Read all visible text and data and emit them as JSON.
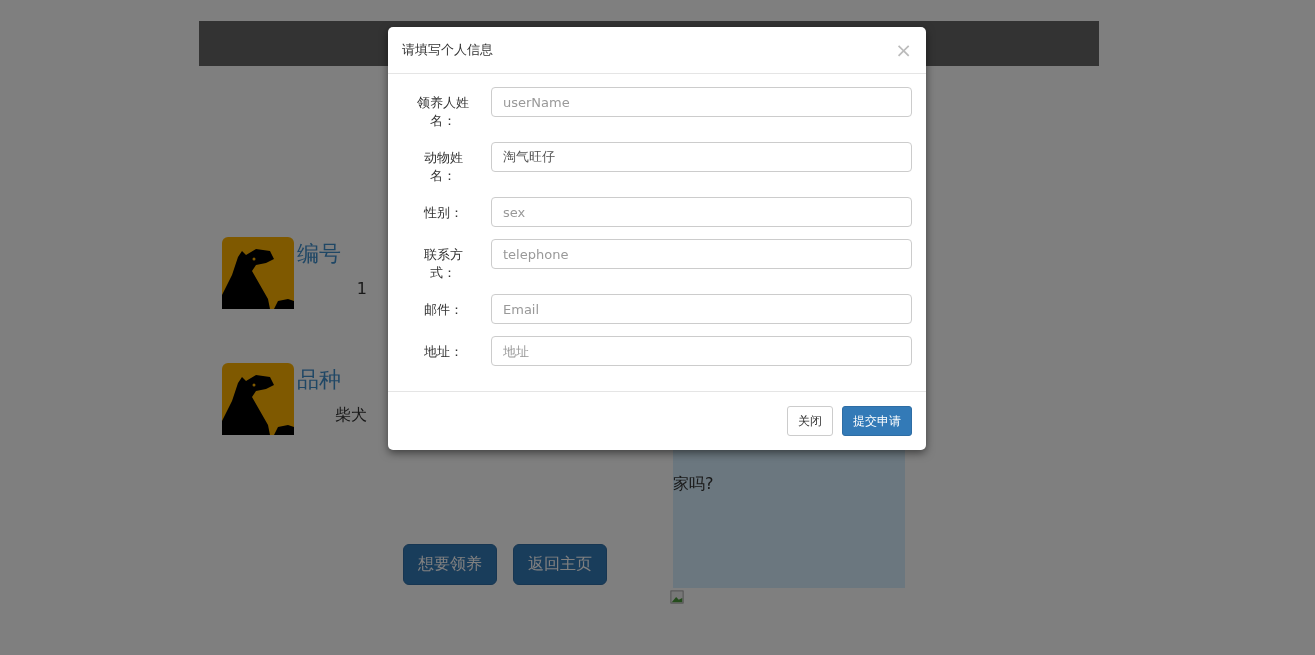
{
  "page": {
    "details": [
      {
        "title": "编号",
        "value": "1"
      },
      {
        "title": "品种",
        "value": "柴犬"
      }
    ],
    "buttons": [
      {
        "label": "想要领养"
      },
      {
        "label": "返回主页"
      }
    ],
    "side_text": "家吗?"
  },
  "dialog": {
    "title": "请填写个人信息",
    "close": "×",
    "fields": [
      {
        "label": "领养人姓名：",
        "placeholder": "userName"
      },
      {
        "label": "动物姓名：",
        "value": "淘气旺仔"
      },
      {
        "label": "性别：",
        "placeholder": "sex"
      },
      {
        "label": "联系方式：",
        "placeholder": "telephone"
      },
      {
        "label": "邮件：",
        "placeholder": "Email"
      },
      {
        "label": "地址：",
        "placeholder": "地址"
      }
    ],
    "buttons": [
      {
        "label": "关闭",
        "kind": "default"
      },
      {
        "label": "提交申请",
        "kind": "primary"
      }
    ]
  }
}
